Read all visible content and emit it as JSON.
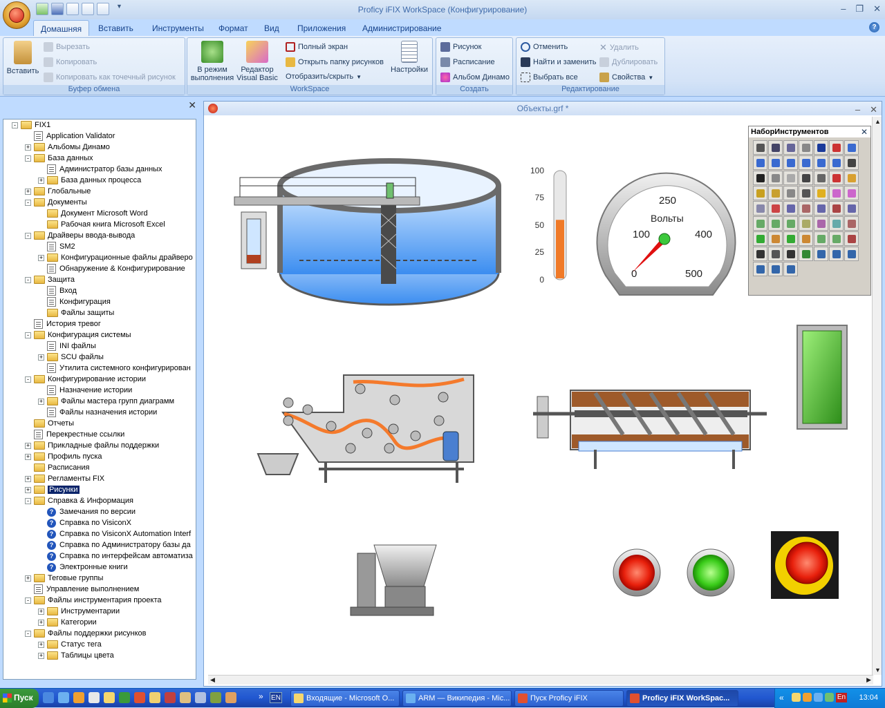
{
  "window": {
    "title": "Proficy iFIX WorkSpace (Конфигурирование)"
  },
  "tabs": [
    "Домашняя",
    "Вставить",
    "Инструменты",
    "Формат",
    "Вид",
    "Приложения",
    "Администрирование"
  ],
  "clipboard": {
    "paste": "Вставить",
    "cut": "Вырезать",
    "copy": "Копировать",
    "copy_bitmap": "Копировать как точечный рисунок",
    "title": "Буфер обмена"
  },
  "workspace": {
    "runtime": "В режим выполнения",
    "vb": "Редактор Visual Basic",
    "fullscreen": "Полный экран",
    "open_folder": "Открыть папку рисунков",
    "show_hide": "Отобразить/скрыть",
    "settings": "Настройки",
    "title": "WorkSpace"
  },
  "create": {
    "picture": "Рисунок",
    "schedule": "Расписание",
    "dynamo": "Альбом Динамо",
    "title": "Создать"
  },
  "editing": {
    "undo": "Отменить",
    "find": "Найти и заменить",
    "select_all": "Выбрать все",
    "delete": "Удалить",
    "duplicate": "Дублировать",
    "properties": "Свойства",
    "title": "Редактирование"
  },
  "tree": [
    {
      "label": "FIX1",
      "level": 0,
      "exp": "-",
      "icon": "folder"
    },
    {
      "label": "Application Validator",
      "level": 1,
      "exp": "",
      "icon": "doc"
    },
    {
      "label": "Альбомы Динамо",
      "level": 1,
      "exp": "+",
      "icon": "folder"
    },
    {
      "label": "База данных",
      "level": 1,
      "exp": "-",
      "icon": "folder"
    },
    {
      "label": "Администратор базы данных",
      "level": 2,
      "exp": "",
      "icon": "doc"
    },
    {
      "label": "База данных процесса",
      "level": 2,
      "exp": "+",
      "icon": "folder"
    },
    {
      "label": "Глобальные",
      "level": 1,
      "exp": "+",
      "icon": "folder"
    },
    {
      "label": "Документы",
      "level": 1,
      "exp": "-",
      "icon": "folder"
    },
    {
      "label": "Документ Microsoft Word",
      "level": 2,
      "exp": "",
      "icon": "folder"
    },
    {
      "label": "Рабочая книга Microsoft Excel",
      "level": 2,
      "exp": "",
      "icon": "folder"
    },
    {
      "label": "Драйверы ввода-вывода",
      "level": 1,
      "exp": "-",
      "icon": "folder"
    },
    {
      "label": "SM2",
      "level": 2,
      "exp": "",
      "icon": "doc"
    },
    {
      "label": "Конфигурационные файлы драйверо",
      "level": 2,
      "exp": "+",
      "icon": "folder"
    },
    {
      "label": "Обнаружение & Конфигурирование",
      "level": 2,
      "exp": "",
      "icon": "doc"
    },
    {
      "label": "Защита",
      "level": 1,
      "exp": "-",
      "icon": "folder"
    },
    {
      "label": "Вход",
      "level": 2,
      "exp": "",
      "icon": "doc"
    },
    {
      "label": "Конфигурация",
      "level": 2,
      "exp": "",
      "icon": "doc"
    },
    {
      "label": "Файлы защиты",
      "level": 2,
      "exp": "",
      "icon": "folder"
    },
    {
      "label": "История тревог",
      "level": 1,
      "exp": "",
      "icon": "doc"
    },
    {
      "label": "Конфигурация системы",
      "level": 1,
      "exp": "-",
      "icon": "folder"
    },
    {
      "label": "INI файлы",
      "level": 2,
      "exp": "",
      "icon": "doc"
    },
    {
      "label": "SCU файлы",
      "level": 2,
      "exp": "+",
      "icon": "folder"
    },
    {
      "label": "Утилита системного конфигурирован",
      "level": 2,
      "exp": "",
      "icon": "doc"
    },
    {
      "label": "Конфигурирование истории",
      "level": 1,
      "exp": "-",
      "icon": "folder"
    },
    {
      "label": "Назначение истории",
      "level": 2,
      "exp": "",
      "icon": "doc"
    },
    {
      "label": "Файлы мастера групп диаграмм",
      "level": 2,
      "exp": "+",
      "icon": "folder"
    },
    {
      "label": "Файлы назначения истории",
      "level": 2,
      "exp": "",
      "icon": "doc"
    },
    {
      "label": "Отчеты",
      "level": 1,
      "exp": "",
      "icon": "folder"
    },
    {
      "label": "Перекрестные ссылки",
      "level": 1,
      "exp": "",
      "icon": "doc"
    },
    {
      "label": "Прикладные файлы поддержки",
      "level": 1,
      "exp": "+",
      "icon": "folder"
    },
    {
      "label": "Профиль пуска",
      "level": 1,
      "exp": "+",
      "icon": "folder"
    },
    {
      "label": "Расписания",
      "level": 1,
      "exp": "",
      "icon": "folder"
    },
    {
      "label": "Регламенты FIX",
      "level": 1,
      "exp": "+",
      "icon": "folder"
    },
    {
      "label": "Рисунки",
      "level": 1,
      "exp": "+",
      "icon": "folder",
      "selected": true
    },
    {
      "label": "Справка & Информация",
      "level": 1,
      "exp": "-",
      "icon": "folder"
    },
    {
      "label": "Замечания по версии",
      "level": 2,
      "exp": "",
      "icon": "help"
    },
    {
      "label": "Справка по VisiconX",
      "level": 2,
      "exp": "",
      "icon": "help"
    },
    {
      "label": "Справка по VisiconX Automation Interf",
      "level": 2,
      "exp": "",
      "icon": "help"
    },
    {
      "label": "Справка по Администратору базы да",
      "level": 2,
      "exp": "",
      "icon": "help"
    },
    {
      "label": "Справка по интерфейсам автоматиза",
      "level": 2,
      "exp": "",
      "icon": "help"
    },
    {
      "label": "Электронные книги",
      "level": 2,
      "exp": "",
      "icon": "help"
    },
    {
      "label": "Теговые группы",
      "level": 1,
      "exp": "+",
      "icon": "folder"
    },
    {
      "label": "Управление выполнением",
      "level": 1,
      "exp": "",
      "icon": "doc"
    },
    {
      "label": "Файлы инструментария проекта",
      "level": 1,
      "exp": "-",
      "icon": "folder"
    },
    {
      "label": "Инструментарии",
      "level": 2,
      "exp": "+",
      "icon": "folder"
    },
    {
      "label": "Категории",
      "level": 2,
      "exp": "+",
      "icon": "folder"
    },
    {
      "label": "Файлы поддержки рисунков",
      "level": 1,
      "exp": "-",
      "icon": "folder"
    },
    {
      "label": "Статус тега",
      "level": 2,
      "exp": "+",
      "icon": "folder"
    },
    {
      "label": "Таблицы цвета",
      "level": 2,
      "exp": "+",
      "icon": "folder"
    }
  ],
  "doc": {
    "title": "Объекты.grf *"
  },
  "gauge": {
    "label": "Вольты",
    "ticks": [
      "0",
      "100",
      "250",
      "400",
      "500"
    ]
  },
  "thermometer": {
    "ticks": [
      "100",
      "75",
      "50",
      "25",
      "0"
    ],
    "level_fraction": 0.55
  },
  "toolbox": {
    "title": "НаборИнструментов"
  },
  "taskbar": {
    "start": "Пуск",
    "lang": "EN",
    "clock": "13:04",
    "tasks": [
      "Входящие - Microsoft O...",
      "ARM — Википедия - Mic...",
      "Пуск Proficy iFIX",
      "Proficy iFIX WorkSpac..."
    ],
    "tray_lang": "En"
  },
  "colors": {
    "accent": "#15428b",
    "ribbon": "#dce8f7",
    "taskbar": "#2157d0"
  }
}
